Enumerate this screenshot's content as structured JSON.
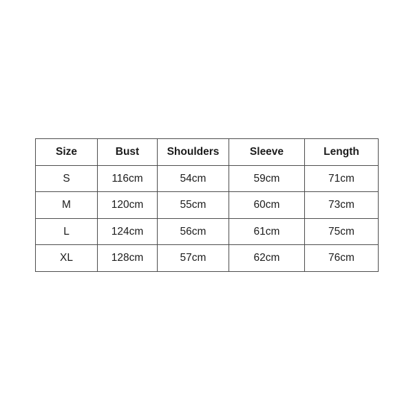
{
  "page": {
    "background_color": "#ffffff",
    "text_color": "#1b1b1b",
    "border_color": "#4a4a4a",
    "outer_border_color": "#6e6e6e"
  },
  "size_chart": {
    "columns": [
      "Size",
      "Bust",
      "Shoulders",
      "Sleeve",
      "Length"
    ],
    "rows": [
      {
        "size": "S",
        "bust": "116cm",
        "shoulders": "54cm",
        "sleeve": "59cm",
        "length": "71cm"
      },
      {
        "size": "M",
        "bust": "120cm",
        "shoulders": "55cm",
        "sleeve": "60cm",
        "length": "73cm"
      },
      {
        "size": "L",
        "bust": "124cm",
        "shoulders": "56cm",
        "sleeve": "61cm",
        "length": "75cm"
      },
      {
        "size": "XL",
        "bust": "128cm",
        "shoulders": "57cm",
        "sleeve": "62cm",
        "length": "76cm"
      }
    ]
  },
  "chart_data": {
    "type": "table",
    "title": "",
    "columns": [
      "Size",
      "Bust",
      "Shoulders",
      "Sleeve",
      "Length"
    ],
    "units": "cm",
    "categories": [
      "S",
      "M",
      "L",
      "XL"
    ],
    "series": [
      {
        "name": "Bust",
        "values": [
          116,
          120,
          124,
          128
        ]
      },
      {
        "name": "Shoulders",
        "values": [
          54,
          55,
          56,
          57
        ]
      },
      {
        "name": "Sleeve",
        "values": [
          59,
          60,
          61,
          62
        ]
      },
      {
        "name": "Length",
        "values": [
          71,
          73,
          75,
          76
        ]
      }
    ],
    "cells": [
      [
        "S",
        "116cm",
        "54cm",
        "59cm",
        "71cm"
      ],
      [
        "M",
        "120cm",
        "55cm",
        "60cm",
        "73cm"
      ],
      [
        "L",
        "124cm",
        "56cm",
        "61cm",
        "75cm"
      ],
      [
        "XL",
        "128cm",
        "57cm",
        "62cm",
        "76cm"
      ]
    ],
    "grid": true,
    "legend": "none"
  }
}
